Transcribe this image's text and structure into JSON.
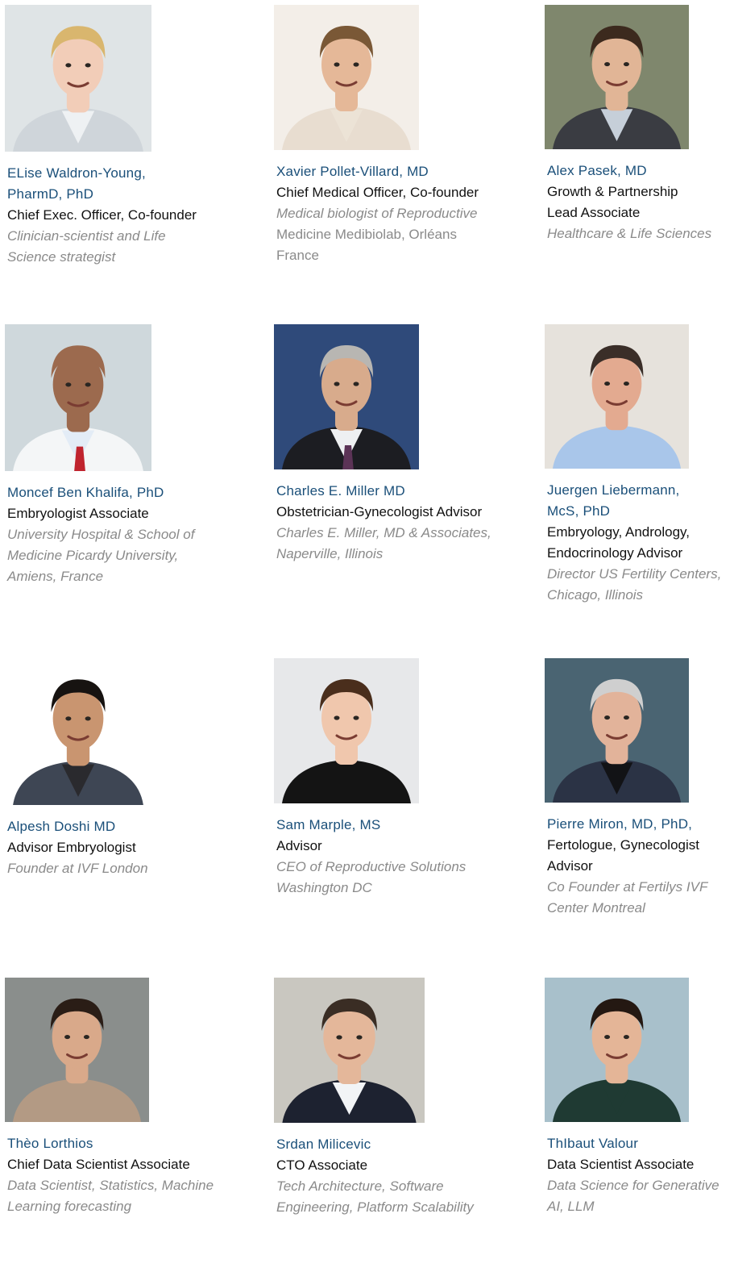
{
  "team": [
    {
      "name": [
        "ELise Waldron-Young,",
        "PharmD, PhD"
      ],
      "role": [
        "Chief Exec. Officer, Co-founder"
      ],
      "desc": [
        "Clinician-scientist and Life",
        "Science strategist"
      ],
      "desc_style": [
        "italic",
        "italic"
      ],
      "photo": {
        "bg": "#dfe4e6",
        "skin": "#f2cdb8",
        "hair": "#d9b66e",
        "shirt": "#eef1f3",
        "jacket": "#cfd5da"
      }
    },
    {
      "name": [
        "Xavier Pollet-Villard, MD"
      ],
      "role": [
        "Chief Medical Officer, Co-founder"
      ],
      "desc": [
        "Medical biologist of Reproductive",
        "Medicine Medibiolab, Orléans",
        "France"
      ],
      "desc_style": [
        "italic",
        "plain",
        "plain"
      ],
      "photo": {
        "bg": "#f3eee8",
        "skin": "#e5b898",
        "hair": "#7a5836",
        "shirt": "#ece3d6",
        "jacket": "#e8ddd0"
      }
    },
    {
      "name": [
        "Alex Pasek, MD"
      ],
      "role": [
        "Growth & Partnership",
        "Lead Associate"
      ],
      "desc": [
        "Healthcare & Life Sciences"
      ],
      "desc_style": [
        "italic"
      ],
      "photo": {
        "bg": "#7f876d",
        "skin": "#e1b596",
        "hair": "#3c2a1e",
        "shirt": "#c6cfd9",
        "jacket": "#3a3c42"
      }
    },
    {
      "name": [
        "Moncef Ben Khalifa, PhD"
      ],
      "role": [
        "Embryologist Associate"
      ],
      "desc": [
        "University Hospital & School of",
        "Medicine Picardy University,",
        "Amiens, France"
      ],
      "desc_style": [
        "italic",
        "italic",
        "italic"
      ],
      "photo": {
        "bg": "#cfd8dc",
        "skin": "#9c6a4e",
        "hair": "#9c6a4e",
        "shirt": "#e3ecf6",
        "jacket": "#f4f6f7",
        "tie": "#c0242e"
      }
    },
    {
      "name": [
        "Charles E. Miller MD"
      ],
      "role": [
        "Obstetrician-Gynecologist Advisor"
      ],
      "desc": [
        "Charles E. Miller, MD & Associates,",
        "Naperville, Illinois"
      ],
      "desc_style": [
        "italic",
        "italic"
      ],
      "photo": {
        "bg": "#2f4a7a",
        "skin": "#d8ab8c",
        "hair": "#b8b6b2",
        "shirt": "#eef0f2",
        "jacket": "#1c1d22",
        "tie": "#5b3356"
      }
    },
    {
      "name": [
        "Juergen Liebermann,",
        "McS, PhD"
      ],
      "role": [
        "Embryology, Andrology,",
        "Endocrinology Advisor"
      ],
      "desc": [
        "Director US Fertility Centers,",
        "Chicago, Illinois"
      ],
      "desc_style": [
        "italic",
        "italic"
      ],
      "photo": {
        "bg": "#e6e2dc",
        "skin": "#e3aa90",
        "hair": "#3a2e28",
        "shirt": "#a9c6ea",
        "jacket": "#a9c6ea"
      }
    },
    {
      "name": [
        "Alpesh Doshi MD"
      ],
      "role": [
        "Advisor Embryologist"
      ],
      "desc": [
        "Founder at IVF London"
      ],
      "desc_style": [
        "italic"
      ],
      "photo": {
        "bg": "#ffffff",
        "skin": "#c99570",
        "hair": "#171311",
        "shirt": "#2a2a2e",
        "jacket": "#3e4654"
      }
    },
    {
      "name": [
        "Sam Marple, MS"
      ],
      "role": [
        "Advisor"
      ],
      "desc": [
        "CEO of Reproductive Solutions",
        "Washington DC"
      ],
      "desc_style": [
        "italic",
        "italic"
      ],
      "photo": {
        "bg": "#e7e8ea",
        "skin": "#f0c7ad",
        "hair": "#4a2e1c",
        "shirt": "#141414",
        "jacket": "#141414"
      }
    },
    {
      "name": [
        "Pierre Miron, MD, PhD,"
      ],
      "role": [
        "Fertologue, Gynecologist",
        "Advisor"
      ],
      "desc": [
        "Co Founder at Fertilys IVF",
        "Center Montreal"
      ],
      "desc_style": [
        "italic",
        "italic"
      ],
      "photo": {
        "bg": "#4a6472",
        "skin": "#e2b39a",
        "hair": "#cfcfcf",
        "shirt": "#121316",
        "jacket": "#2b3345"
      }
    },
    {
      "name": [
        "Thèo Lorthios"
      ],
      "role": [
        "Chief Data Scientist Associate"
      ],
      "desc": [
        "Data Scientist, Statistics, Machine",
        "Learning forecasting"
      ],
      "desc_style": [
        "italic",
        "italic"
      ],
      "photo": {
        "bg": "#8a8e8c",
        "skin": "#d9a98a",
        "hair": "#2a1d16",
        "shirt": "#b39a84",
        "jacket": "#b39a84"
      }
    },
    {
      "name": [
        "Srdan Milicevic"
      ],
      "role": [
        "CTO Associate"
      ],
      "desc": [
        "Tech Architecture, Software",
        "Engineering, Platform Scalability"
      ],
      "desc_style": [
        "italic",
        "italic"
      ],
      "photo": {
        "bg": "#c9c7c0",
        "skin": "#e4b79a",
        "hair": "#3a2d24",
        "shirt": "#f2f4f6",
        "jacket": "#1d2230"
      }
    },
    {
      "name": [
        "ThIbaut Valour"
      ],
      "role": [
        "Data Scientist Associate"
      ],
      "desc": [
        "Data Science for Generative",
        "AI, LLM"
      ],
      "desc_style": [
        "italic",
        "italic"
      ],
      "photo": {
        "bg": "#a8c0cb",
        "skin": "#e4b597",
        "hair": "#241812",
        "shirt": "#1f3a33",
        "jacket": "#1f3a33"
      }
    }
  ]
}
